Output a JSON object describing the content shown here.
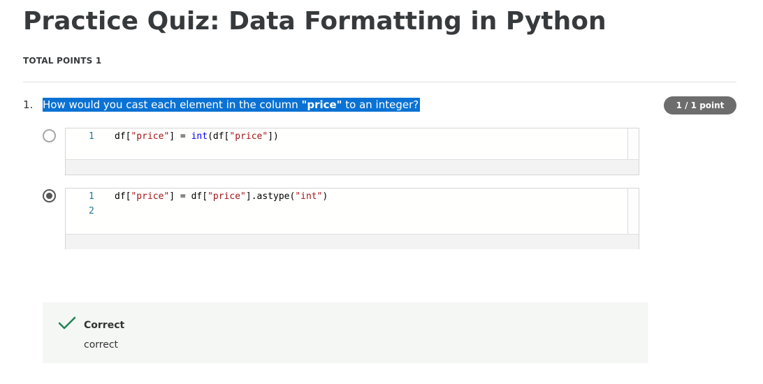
{
  "quiz": {
    "title": "Practice Quiz: Data Formatting in Python",
    "total_points": "TOTAL POINTS 1"
  },
  "question": {
    "number": "1.",
    "text_before": "How would you cast each element in the column ",
    "text_bold": "\"price\"",
    "text_after": " to an integer?",
    "points_badge": "1 / 1 point",
    "highlight_color": "#0a72d4"
  },
  "options": [
    {
      "selected": false,
      "lines": [
        {
          "number": "1",
          "tokens": [
            {
              "text": "df[",
              "kind": "plain"
            },
            {
              "text": "\"price\"",
              "kind": "str"
            },
            {
              "text": "] = ",
              "kind": "plain"
            },
            {
              "text": "int",
              "kind": "fn"
            },
            {
              "text": "(df[",
              "kind": "plain"
            },
            {
              "text": "\"price\"",
              "kind": "str"
            },
            {
              "text": "])",
              "kind": "plain"
            }
          ]
        }
      ]
    },
    {
      "selected": true,
      "lines": [
        {
          "number": "1",
          "tokens": [
            {
              "text": "df[",
              "kind": "plain"
            },
            {
              "text": "\"price\"",
              "kind": "str"
            },
            {
              "text": "] = df[",
              "kind": "plain"
            },
            {
              "text": "\"price\"",
              "kind": "str"
            },
            {
              "text": "].astype(",
              "kind": "plain"
            },
            {
              "text": "\"int\"",
              "kind": "str"
            },
            {
              "text": ")",
              "kind": "plain"
            }
          ]
        },
        {
          "number": "2",
          "tokens": []
        }
      ]
    }
  ],
  "feedback": {
    "icon": "checkmark-icon",
    "title": "Correct",
    "body": "correct",
    "accent_color": "#1f8354"
  }
}
